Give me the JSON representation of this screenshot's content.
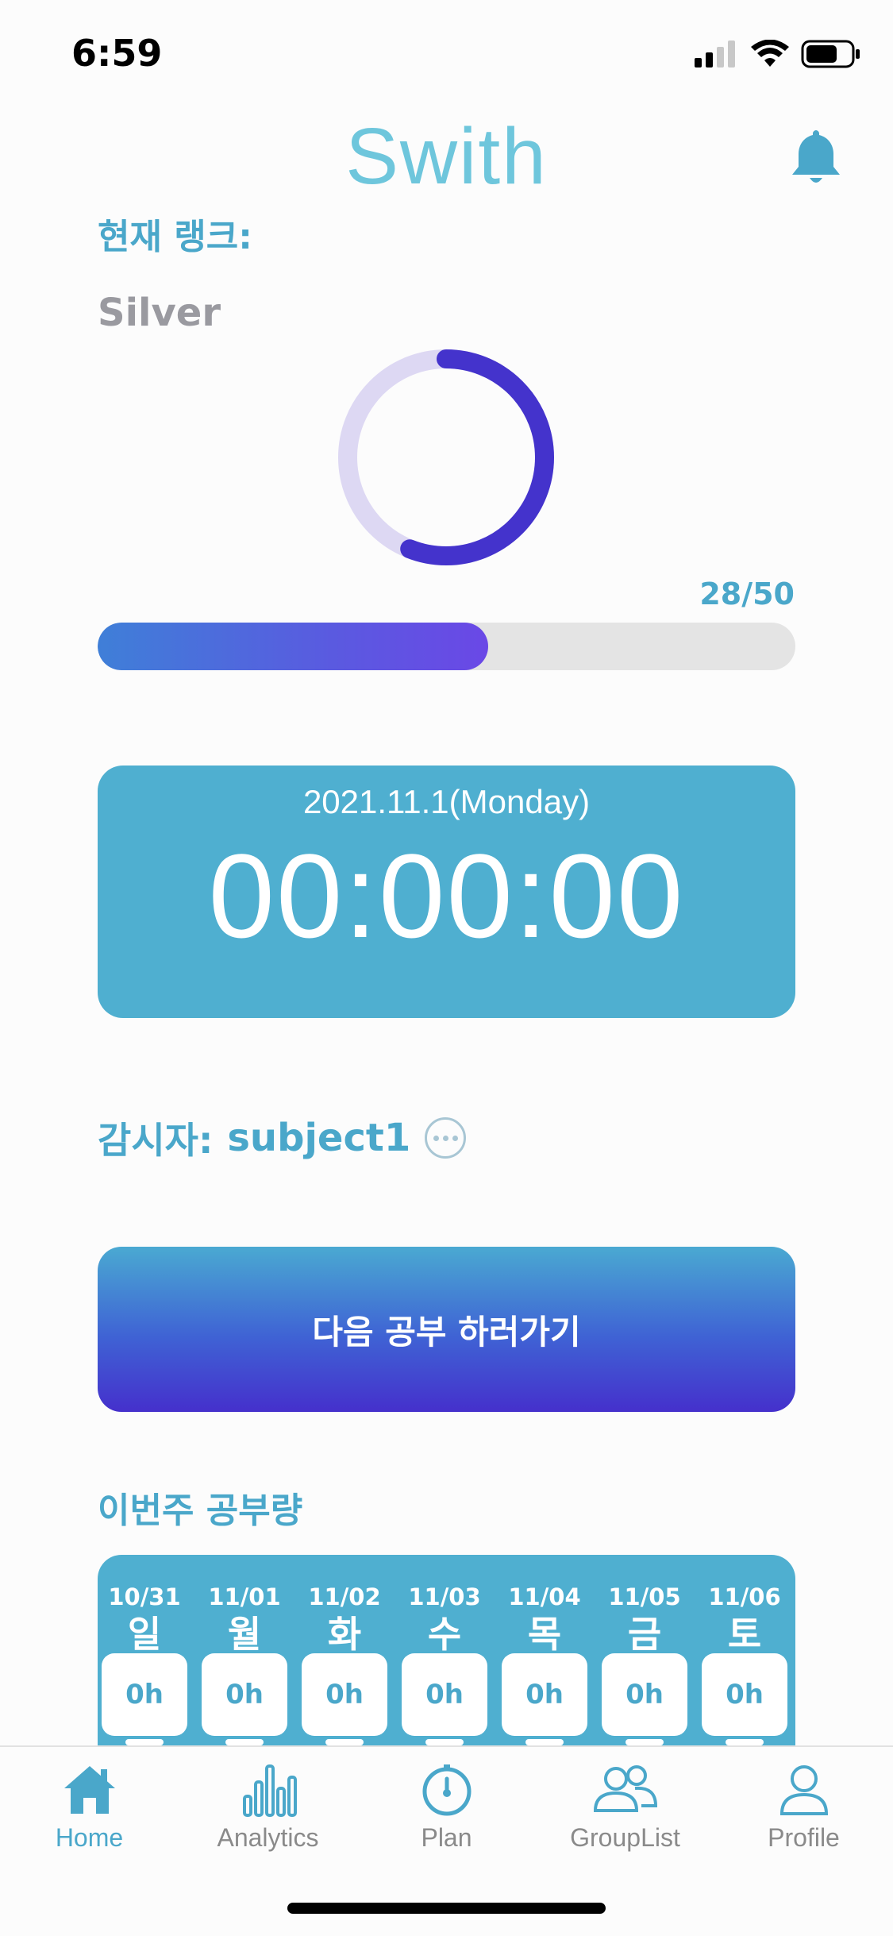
{
  "status_bar": {
    "time": "6:59"
  },
  "header": {
    "title": "Swith",
    "bell_icon": "bell-icon"
  },
  "rank": {
    "label": "현재 랭크:",
    "value": "Silver",
    "ring_progress": 0.56
  },
  "progress": {
    "count_text": "28/50",
    "current": 28,
    "total": 50
  },
  "timer": {
    "date": "2021.11.1(Monday)",
    "time": "00:00:00"
  },
  "supervisor": {
    "label": "감시자:",
    "name": "subject1",
    "more_icon": "more-icon"
  },
  "next_button": {
    "label": "다음 공부 하러가기"
  },
  "week": {
    "title": "이번주 공부량",
    "days": [
      {
        "date": "10/31",
        "name": "일",
        "hours": "0h"
      },
      {
        "date": "11/01",
        "name": "월",
        "hours": "0h"
      },
      {
        "date": "11/02",
        "name": "화",
        "hours": "0h"
      },
      {
        "date": "11/03",
        "name": "수",
        "hours": "0h"
      },
      {
        "date": "11/04",
        "name": "목",
        "hours": "0h"
      },
      {
        "date": "11/05",
        "name": "금",
        "hours": "0h"
      },
      {
        "date": "11/06",
        "name": "토",
        "hours": "0h"
      }
    ]
  },
  "tabbar": {
    "items": [
      {
        "label": "Home",
        "icon": "home-icon",
        "active": true
      },
      {
        "label": "Analytics",
        "icon": "bar-chart-icon",
        "active": false
      },
      {
        "label": "Plan",
        "icon": "stopwatch-icon",
        "active": false
      },
      {
        "label": "GroupList",
        "icon": "group-icon",
        "active": false
      },
      {
        "label": "Profile",
        "icon": "profile-icon",
        "active": false
      }
    ]
  },
  "colors": {
    "accent": "#4aa7ca",
    "card": "#4fafd0",
    "ring_track": "#ddd8f3",
    "ring_fill": "#4433cc"
  }
}
